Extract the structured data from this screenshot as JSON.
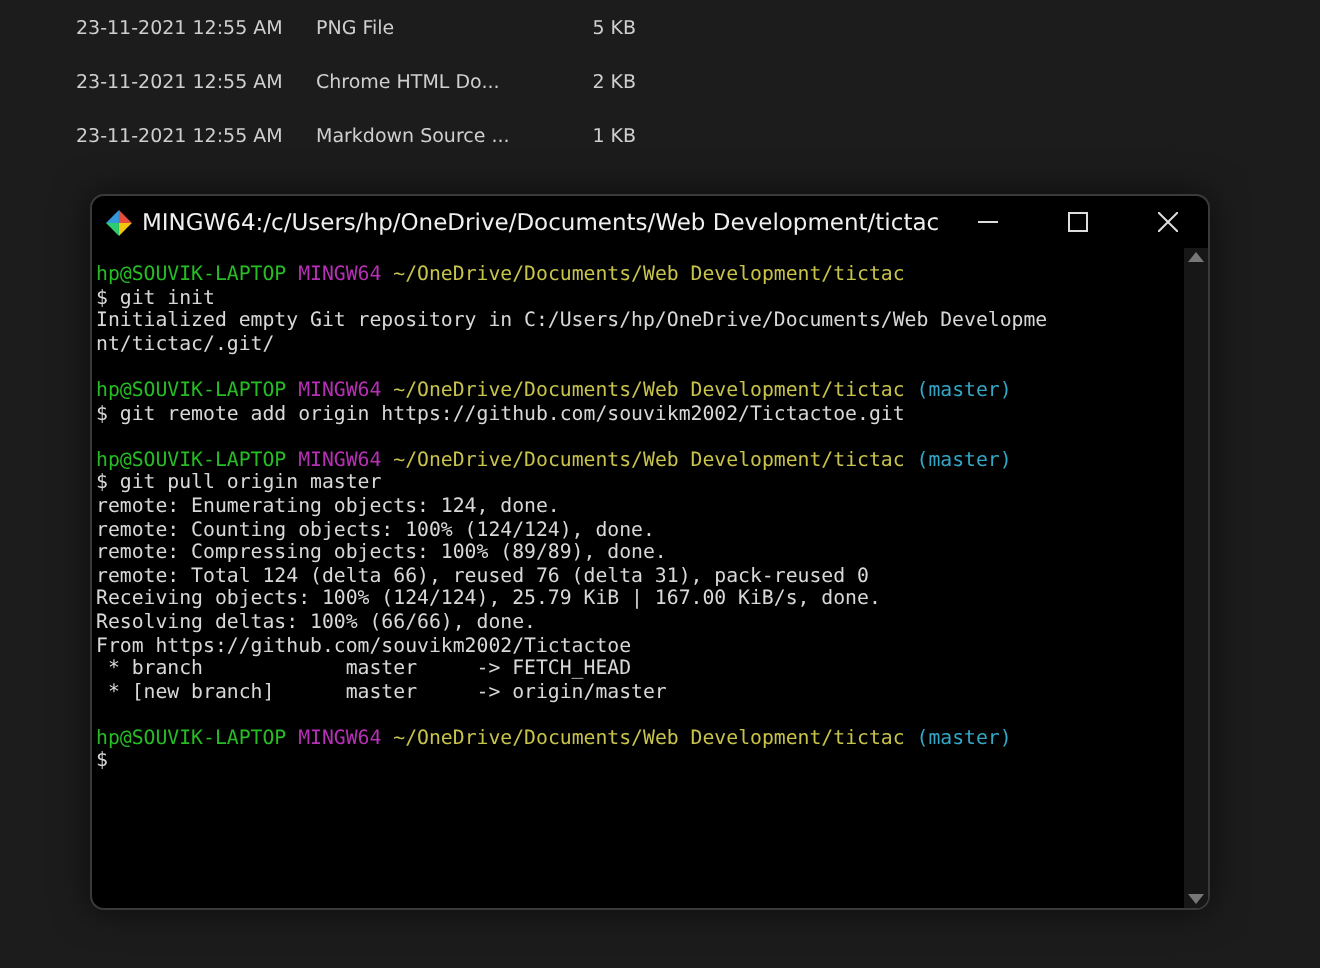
{
  "explorer": {
    "rows": [
      {
        "date": "23-11-2021 12:55 AM",
        "type": "PNG File",
        "size": "5 KB"
      },
      {
        "date": "23-11-2021 12:55 AM",
        "type": "Chrome HTML Do...",
        "size": "2 KB"
      },
      {
        "date": "23-11-2021 12:55 AM",
        "type": "Markdown Source ...",
        "size": "1 KB"
      }
    ]
  },
  "terminal": {
    "title": "MINGW64:/c/Users/hp/OneDrive/Documents/Web Development/tictac",
    "lines": [
      {
        "kind": "prompt",
        "user": "hp@SOUVIK-LAPTOP",
        "host": "MINGW64",
        "path": "~/OneDrive/Documents/Web Development/tictac"
      },
      {
        "kind": "output",
        "text": "$ git init"
      },
      {
        "kind": "output",
        "text": "Initialized empty Git repository in C:/Users/hp/OneDrive/Documents/Web Developme"
      },
      {
        "kind": "output",
        "text": "nt/tictac/.git/"
      },
      {
        "kind": "blank"
      },
      {
        "kind": "prompt",
        "user": "hp@SOUVIK-LAPTOP",
        "host": "MINGW64",
        "path": "~/OneDrive/Documents/Web Development/tictac",
        "branch": "(master)"
      },
      {
        "kind": "output",
        "text": "$ git remote add origin https://github.com/souvikm2002/Tictactoe.git"
      },
      {
        "kind": "blank"
      },
      {
        "kind": "prompt",
        "user": "hp@SOUVIK-LAPTOP",
        "host": "MINGW64",
        "path": "~/OneDrive/Documents/Web Development/tictac",
        "branch": "(master)"
      },
      {
        "kind": "output",
        "text": "$ git pull origin master"
      },
      {
        "kind": "output",
        "text": "remote: Enumerating objects: 124, done."
      },
      {
        "kind": "output",
        "text": "remote: Counting objects: 100% (124/124), done."
      },
      {
        "kind": "output",
        "text": "remote: Compressing objects: 100% (89/89), done."
      },
      {
        "kind": "output",
        "text": "remote: Total 124 (delta 66), reused 76 (delta 31), pack-reused 0"
      },
      {
        "kind": "output",
        "text": "Receiving objects: 100% (124/124), 25.79 KiB | 167.00 KiB/s, done."
      },
      {
        "kind": "output",
        "text": "Resolving deltas: 100% (66/66), done."
      },
      {
        "kind": "output",
        "text": "From https://github.com/souvikm2002/Tictactoe"
      },
      {
        "kind": "output",
        "text": " * branch            master     -> FETCH_HEAD"
      },
      {
        "kind": "output",
        "text": " * [new branch]      master     -> origin/master"
      },
      {
        "kind": "blank"
      },
      {
        "kind": "prompt",
        "user": "hp@SOUVIK-LAPTOP",
        "host": "MINGW64",
        "path": "~/OneDrive/Documents/Web Development/tictac",
        "branch": "(master)"
      },
      {
        "kind": "output",
        "text": "$"
      }
    ]
  }
}
